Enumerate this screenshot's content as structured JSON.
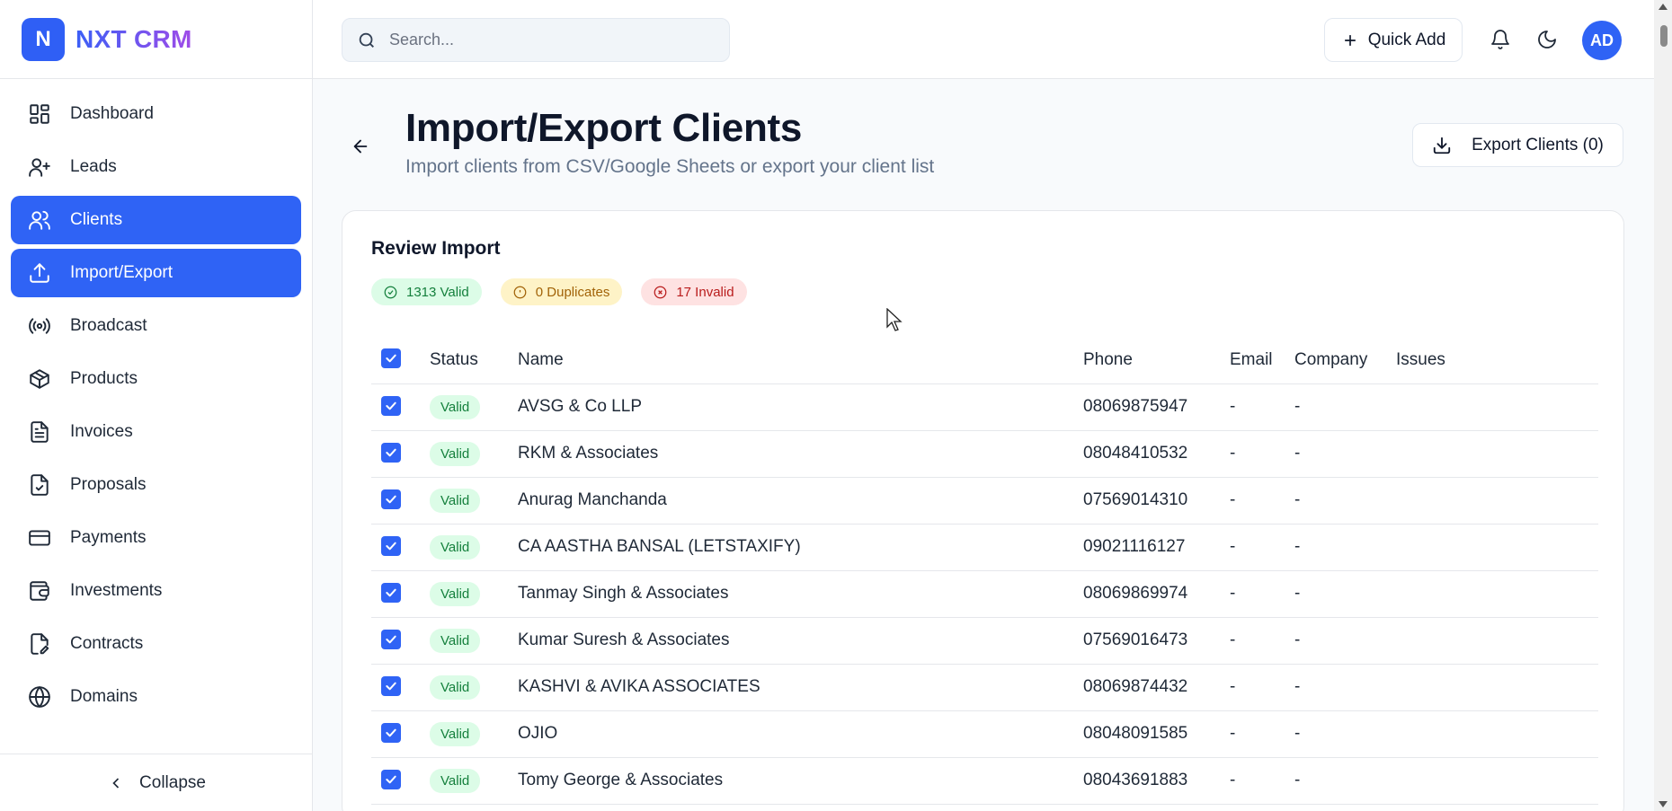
{
  "brand": {
    "logo_letter": "N",
    "name": "NXT CRM"
  },
  "sidebar": {
    "items": [
      {
        "label": "Dashboard",
        "icon": "dashboard-icon",
        "active": false
      },
      {
        "label": "Leads",
        "icon": "user-plus-icon",
        "active": false
      },
      {
        "label": "Clients",
        "icon": "users-icon",
        "active": true
      },
      {
        "label": "Import/Export",
        "icon": "upload-icon",
        "active": true
      },
      {
        "label": "Broadcast",
        "icon": "broadcast-icon",
        "active": false
      },
      {
        "label": "Products",
        "icon": "package-icon",
        "active": false
      },
      {
        "label": "Invoices",
        "icon": "file-text-icon",
        "active": false
      },
      {
        "label": "Proposals",
        "icon": "file-check-icon",
        "active": false
      },
      {
        "label": "Payments",
        "icon": "credit-card-icon",
        "active": false
      },
      {
        "label": "Investments",
        "icon": "wallet-icon",
        "active": false
      },
      {
        "label": "Contracts",
        "icon": "file-signature-icon",
        "active": false
      },
      {
        "label": "Domains",
        "icon": "globe-icon",
        "active": false
      }
    ],
    "collapse_label": "Collapse"
  },
  "header": {
    "search_placeholder": "Search...",
    "quick_add_label": "Quick Add",
    "avatar_initials": "AD"
  },
  "page": {
    "title": "Import/Export Clients",
    "subtitle": "Import clients from CSV/Google Sheets or export your client list",
    "export_label": "Export Clients (0)"
  },
  "review": {
    "title": "Review Import",
    "valid_label": "1313 Valid",
    "duplicates_label": "0 Duplicates",
    "invalid_label": "17 Invalid",
    "columns": [
      "Status",
      "Name",
      "Phone",
      "Email",
      "Company",
      "Issues"
    ],
    "rows": [
      {
        "status": "Valid",
        "name": "AVSG & Co LLP",
        "phone": "08069875947",
        "email": "-",
        "company": "-",
        "issues": ""
      },
      {
        "status": "Valid",
        "name": "RKM & Associates",
        "phone": "08048410532",
        "email": "-",
        "company": "-",
        "issues": ""
      },
      {
        "status": "Valid",
        "name": "Anurag Manchanda",
        "phone": "07569014310",
        "email": "-",
        "company": "-",
        "issues": ""
      },
      {
        "status": "Valid",
        "name": "CA AASTHA BANSAL (LETSTAXIFY)",
        "phone": "09021116127",
        "email": "-",
        "company": "-",
        "issues": ""
      },
      {
        "status": "Valid",
        "name": "Tanmay Singh & Associates",
        "phone": "08069869974",
        "email": "-",
        "company": "-",
        "issues": ""
      },
      {
        "status": "Valid",
        "name": "Kumar Suresh & Associates",
        "phone": "07569016473",
        "email": "-",
        "company": "-",
        "issues": ""
      },
      {
        "status": "Valid",
        "name": "KASHVI & AVIKA ASSOCIATES",
        "phone": "08069874432",
        "email": "-",
        "company": "-",
        "issues": ""
      },
      {
        "status": "Valid",
        "name": "OJIO",
        "phone": "08048091585",
        "email": "-",
        "company": "-",
        "issues": ""
      },
      {
        "status": "Valid",
        "name": "Tomy George & Associates",
        "phone": "08043691883",
        "email": "-",
        "company": "-",
        "issues": ""
      }
    ]
  },
  "colors": {
    "accent": "#2f63f5",
    "valid": "#15803d",
    "duplicate": "#a16207",
    "invalid": "#b91c1c"
  }
}
